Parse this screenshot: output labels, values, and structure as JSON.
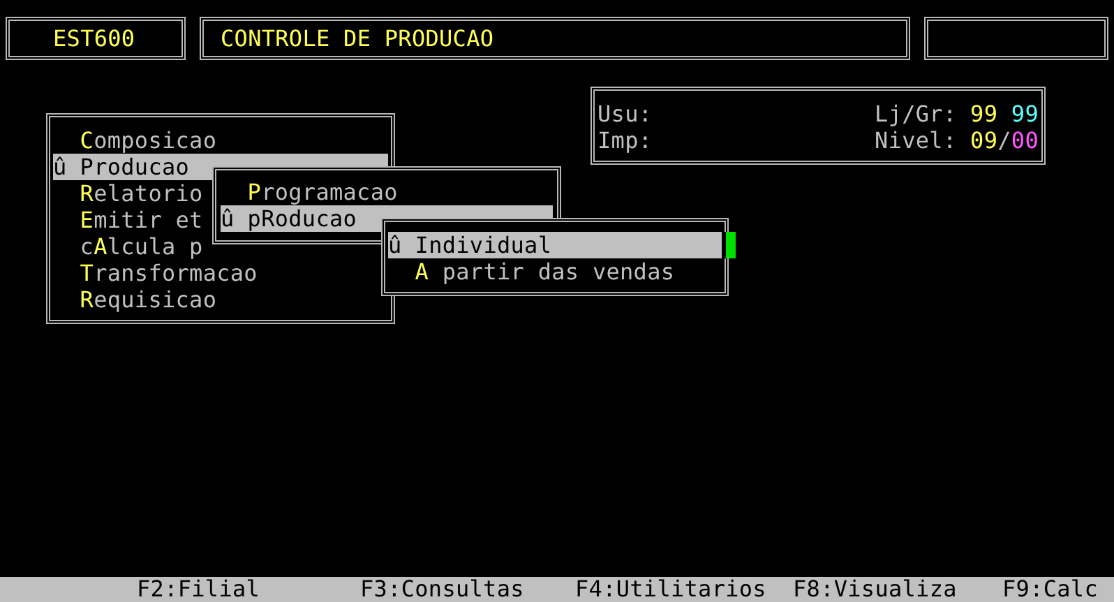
{
  "header": {
    "program_code": "EST600",
    "title": "CONTROLE DE PRODUCAO"
  },
  "info": {
    "user_label": "Usu:",
    "printer_label": "Imp:",
    "store_group_label": "Lj/Gr:",
    "store": "99",
    "group": "99",
    "level_label": "Nivel:",
    "level_a": "09",
    "separator": "/",
    "level_b": "00"
  },
  "menus": [
    {
      "cursor": false,
      "items": [
        {
          "key": "C",
          "after": "omposicao",
          "selected": false
        },
        {
          "marker": "û",
          "key": "P",
          "after": "roducao",
          "selected": true
        },
        {
          "key": "R",
          "after": "elatorio",
          "selected": false
        },
        {
          "key": "E",
          "after": "mitir et",
          "selected": false
        },
        {
          "before": "c",
          "key": "A",
          "after": "lcula p",
          "selected": false
        },
        {
          "key": "T",
          "after": "ransformacao",
          "selected": false
        },
        {
          "key": "R",
          "after": "equisicao",
          "selected": false
        }
      ]
    },
    {
      "cursor": false,
      "items": [
        {
          "key": "P",
          "after": "rogramacao",
          "selected": false
        },
        {
          "marker": "û",
          "before": "p",
          "key": "R",
          "after": "oducao",
          "selected": true
        }
      ]
    },
    {
      "cursor": true,
      "items": [
        {
          "marker": "û",
          "key": "I",
          "after": "ndividual",
          "selected": true
        },
        {
          "key": "A",
          "after": " partir das vendas",
          "selected": false
        }
      ]
    }
  ],
  "status_bar": [
    "F2:Filial",
    "F3:Consultas",
    "F4:Utilitarios",
    "F8:Visualiza",
    "F9:Calc"
  ]
}
